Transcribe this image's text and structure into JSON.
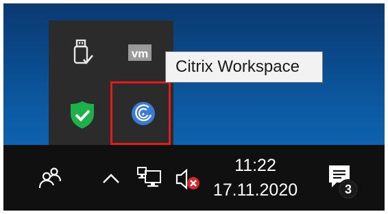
{
  "tray": {
    "items": [
      {
        "name": "usb-eject-icon"
      },
      {
        "name": "vmware-icon",
        "text": "vm"
      },
      {
        "name": "windows-security-shield-icon"
      },
      {
        "name": "citrix-workspace-icon"
      }
    ],
    "tooltip": "Citrix Workspace",
    "highlight_color": "#e31b1b"
  },
  "taskbar": {
    "time": "11:22",
    "date": "17.11.2020",
    "notification_count": "3",
    "icons": [
      "people-icon",
      "show-hidden-icons-chevron",
      "network-icon",
      "volume-muted-icon",
      "action-center-icon"
    ]
  },
  "colors": {
    "desktop": "#0a4a8c",
    "taskbar": "#101010",
    "flyout": "#2b2b2b",
    "shield": "#1db14a",
    "citrix": "#3a7bd5",
    "muted_x": "#d9262b"
  }
}
